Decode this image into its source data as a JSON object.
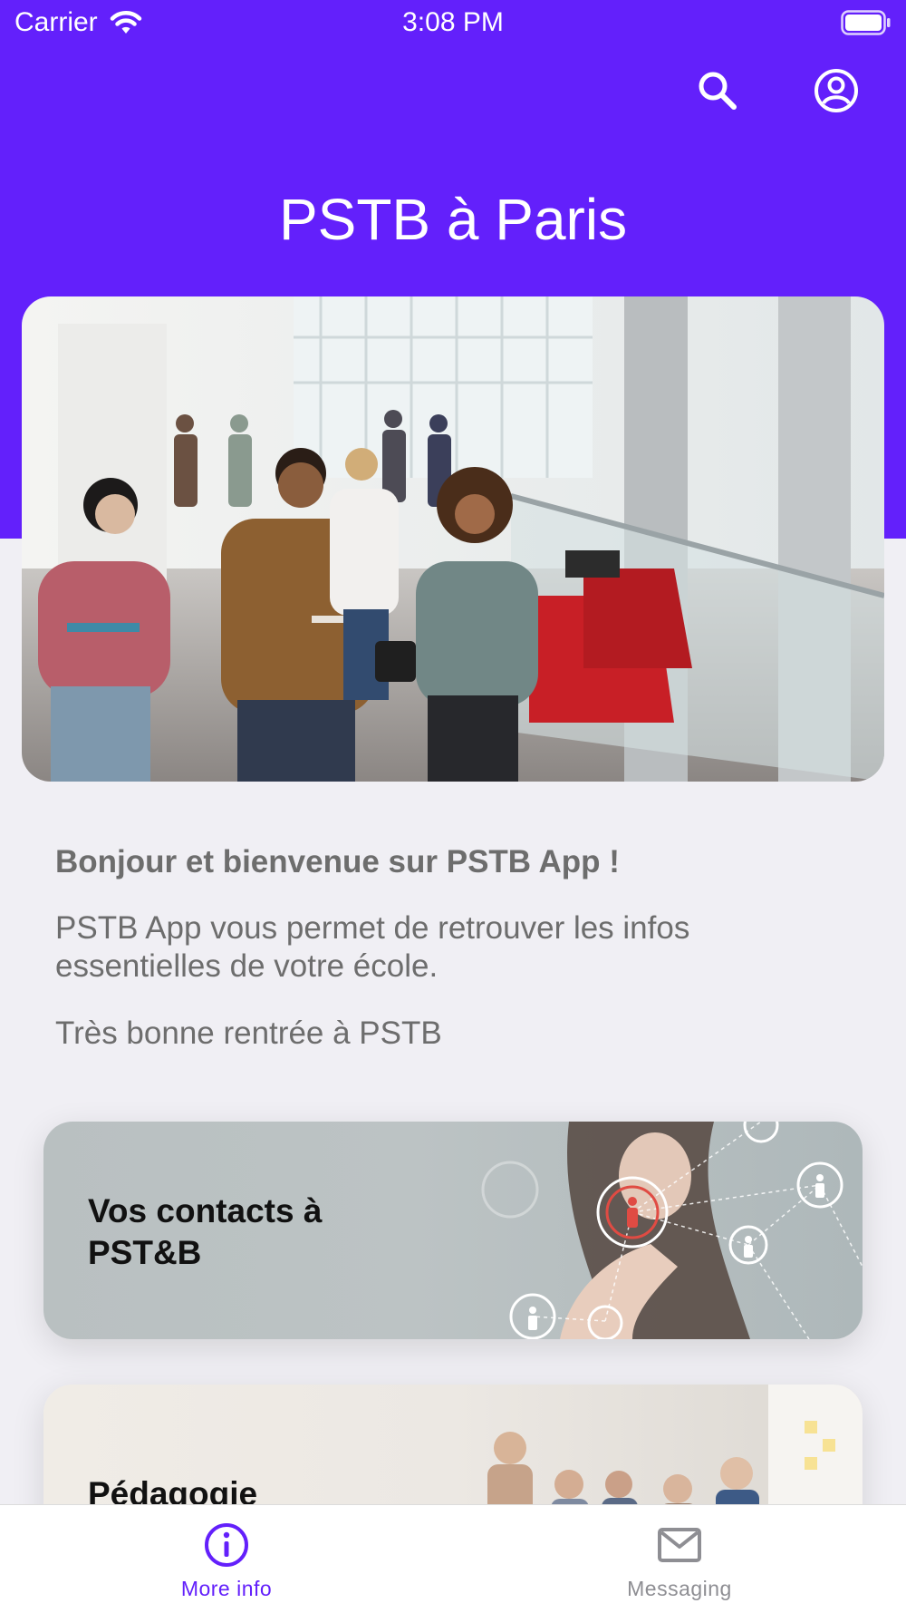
{
  "colors": {
    "brand": "#6320fb",
    "tab_inactive": "#8e8e93",
    "text_muted": "#6d6d6d"
  },
  "status_bar": {
    "carrier": "Carrier",
    "time": "3:08 PM"
  },
  "header": {
    "title": "PSTB à Paris",
    "search_icon": "search-icon",
    "profile_icon": "user-circle-icon"
  },
  "hero": {
    "image": "students-walking-in-campus-atrium"
  },
  "welcome": {
    "heading": "Bonjour et bienvenue sur PSTB App  !",
    "paragraph1": "PSTB App vous permet de retrouver les infos essentielles de votre école.",
    "paragraph2": "Très bonne rentrée à PSTB"
  },
  "cards": [
    {
      "title": "Vos contacts à PST&B",
      "image": "hand-touching-network-contacts"
    },
    {
      "title": "Pédagogie",
      "image": "classroom-meeting"
    }
  ],
  "tabs": [
    {
      "label": "More info",
      "icon": "info-circle-icon",
      "active": true
    },
    {
      "label": "Messaging",
      "icon": "envelope-icon",
      "active": false
    }
  ]
}
